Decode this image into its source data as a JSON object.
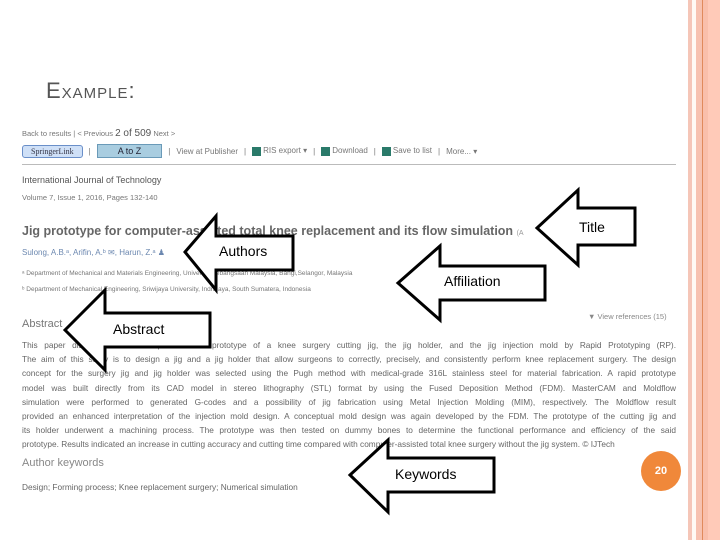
{
  "slide": {
    "title": "Example:",
    "page_number": "20",
    "accent": "#f0883a"
  },
  "screenshot": {
    "nav": {
      "back": "Back to results",
      "sep": "|",
      "previous": "< Previous",
      "position": "2 of 509",
      "next": "Next >"
    },
    "toolbar": {
      "springer": "SpringerLink",
      "atoz": "A to Z",
      "view_publisher": "View at Publisher",
      "ris_export": "RIS export",
      "download": "Download",
      "save_to_list": "Save to list",
      "more": "More..."
    },
    "journal": "International Journal of Technology",
    "volume": "Volume 7, Issue 1, 2016, Pages 132-140",
    "paper_title": "Jig prototype for computer-assisted total knee replacement and its flow simulation",
    "paper_type": "(A",
    "authors": "Sulong, A.B.ᵃ, Arifin, A.ᵇ ✉, Harun, Z.ᵃ ♟",
    "affiliations": [
      "ᵃ Department of Mechanical and Materials Engineering, Universiti Kebangsaan Malaysia, Bangi,Selangor, Malaysia",
      "ᵇ Department of Mechanical Engineering, Sriwijaya University, Indralaya, South Sumatera, Indonesia"
    ],
    "abstract_heading": "Abstract",
    "view_references": "▼ View references (15)",
    "abstract_lines": [
      "This paper discusses the development of a prototype of a knee surgery cutting jig, the jig holder, and the jig injection mold by Rapid Prototyping (RP).",
      "The aim of this study is to design a jig and a jig holder that allow surgeons to correctly, precisely, and consistently perform knee replacement surgery. The design",
      "concept for the surgery jig and jig holder was selected using the Pugh method with medical-grade 316L stainless steel for material fabrication. A rapid prototype",
      "model was built directly from its CAD model in stereo lithography (STL) format by using the Fused Deposition Method (FDM). MasterCAM and Moldflow",
      "simulation were performed to generated G-codes and a possibility of jig fabrication using Metal Injection Molding (MIM), respectively. The Moldflow result",
      "provided an enhanced interpretation of the injection mold design. A conceptual mold design was again developed by the FDM. The prototype of the cutting jig and",
      "its holder underwent a machining process. The prototype was then tested on dummy bones to determine the functional performance and efficiency of the said",
      "prototype. Results indicated an increase in cutting accuracy and cutting time compared with computer-assisted total knee surgery without the jig system. © IJTech"
    ],
    "keywords_heading": "Author keywords",
    "keywords": "Design; Forming process; Knee replacement surgery; Numerical simulation"
  },
  "callouts": {
    "title": "Title",
    "authors": "Authors",
    "affiliation": "Affiliation",
    "abstract": "Abstract",
    "keywords": "Keywords"
  }
}
